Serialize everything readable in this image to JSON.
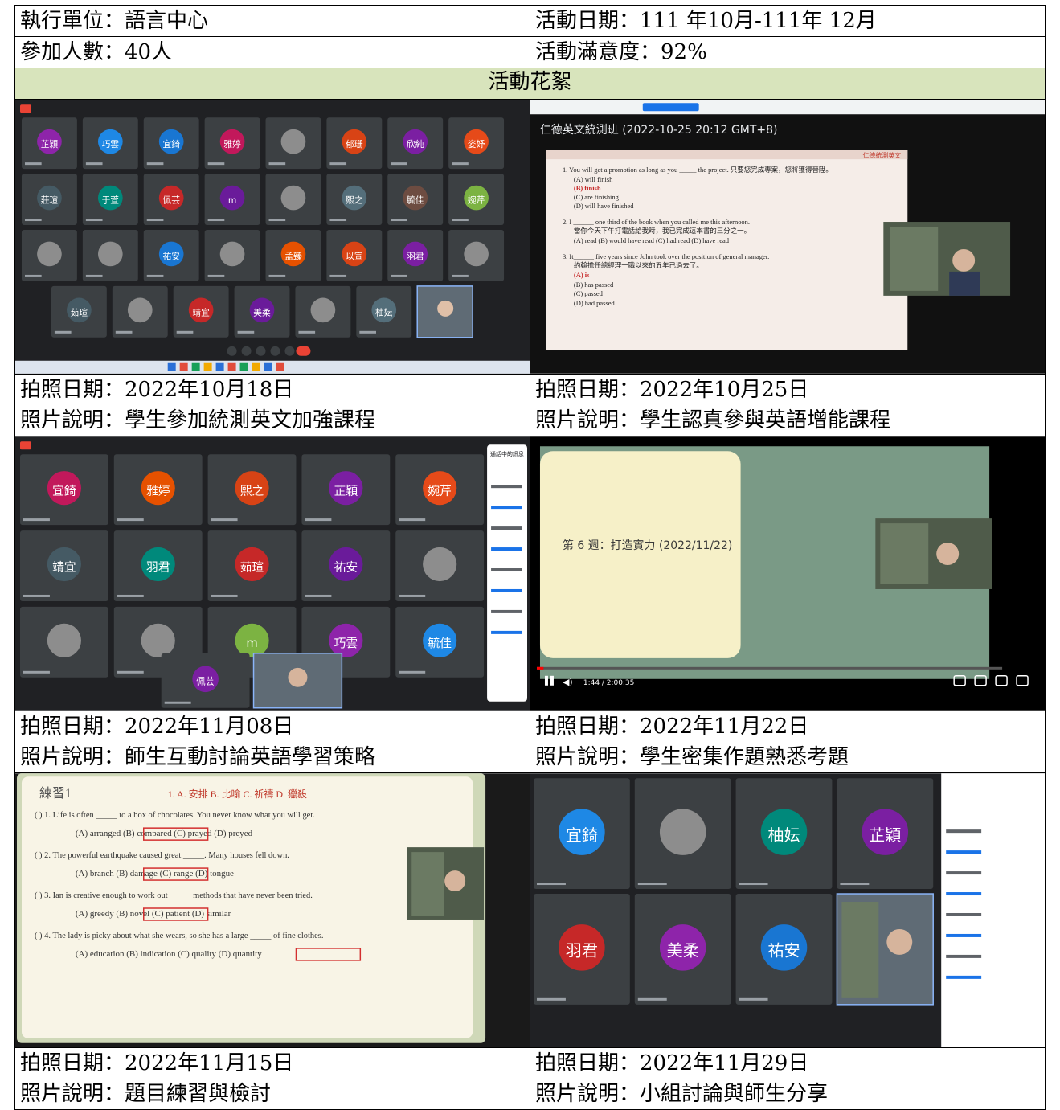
{
  "info": {
    "unit": "執行單位：語言中心",
    "date_range": "活動日期：111  年10月-111年 12月",
    "participants": "參加人數：40人",
    "satisfaction": "活動滿意度：92%"
  },
  "section_title": "活動花絮",
  "photos": [
    {
      "date": "拍照日期：2022年10月18日",
      "caption": "照片說明：學生參加統測英文加強課程",
      "tiles": [
        "芷穎",
        "巧雲",
        "宜錡",
        "雅婷",
        "",
        "郁珊",
        "欣純",
        "姿妤",
        "莊瑄",
        "于萱",
        "佩芸",
        "m",
        "",
        "熙之",
        "毓佳",
        "婉芹",
        "",
        "",
        "祐安",
        "",
        "孟臻",
        "以宣",
        "羽君",
        "",
        "茹瑄",
        "",
        "靖宜",
        "美柔",
        "",
        "柚妘"
      ]
    },
    {
      "date": "拍照日期：2022年10月25日",
      "caption": "照片說明：學生認真參與英語增能課程",
      "window_title": "仁德英文統測班 (2022-10-25 20:12 GMT+8)",
      "slide_tag": "仁德統測英文",
      "lines": [
        "1.  You will get a promotion as long as you _____ the project. 只要您完成專案，您將獲得晉陞。",
        "(A) will finish",
        "(B) finish",
        "(C) are finishing",
        "(D) will have finished",
        "2. I ______ one third of the book when you called me this afternoon.",
        "當你今天下午打電話給我時，我已完成這本書的三分之一。",
        "(A) read        (B) would have read        (C) had read        (D) have read",
        "3. It______ five years since John took over the position of general manager.",
        "約翰擔任總經理一職以來的五年已過去了。",
        "(A) is",
        "(B) has passed",
        "(C) passed",
        "(D) had passed"
      ]
    },
    {
      "date": "拍照日期：2022年11月08日",
      "caption": "照片說明：師生互動討論英語學習策略",
      "tiles": [
        "宜錡",
        "雅婷",
        "熙之",
        "芷穎",
        "婉芹",
        "靖宜",
        "羽君",
        "茹瑄",
        "祐安",
        "",
        "",
        "",
        "m",
        "巧雲",
        "毓佳",
        "佩芸"
      ],
      "chat_title": "通話中的訊息"
    },
    {
      "date": "拍照日期：2022年11月22日",
      "caption": "照片說明：學生密集作題熟悉考題",
      "slide_text": "第 6 週：打造實力 (2022/11/22)",
      "time": "1:44 / 2:00:35"
    },
    {
      "date": "拍照日期：2022年11月15日",
      "caption": "照片說明：題目練習與檢討",
      "title": "練習1",
      "answers": "1. A. 安排 B. 比喻 C. 祈禱  D. 獵殺",
      "lines": [
        "(   )  1. Life is often _____ to a box of chocolates. You never know what you will get.",
        "(A) arranged      (B) compared      (C) prayed      (D) preyed",
        "(   )  2. The powerful earthquake caused great _____. Many houses fell down.",
        "(A) branch      (B) damage      (C) range      (D) tongue",
        "(   )  3. Ian is creative enough to work out _____ methods that have never been tried.",
        "(A) greedy      (B) novel      (C) patient      (D) similar",
        "(   )  4. The lady is picky about what she wears, so she has a large _____ of fine clothes.",
        "(A) education      (B) indication      (C) quality      (D) quantity"
      ]
    },
    {
      "date": "拍照日期：2022年11月29日",
      "caption": "照片說明：小組討論與師生分享",
      "tiles": [
        "宜錡",
        "",
        "柚妘",
        "芷穎",
        "羽君",
        "美柔",
        "祐安"
      ]
    }
  ]
}
